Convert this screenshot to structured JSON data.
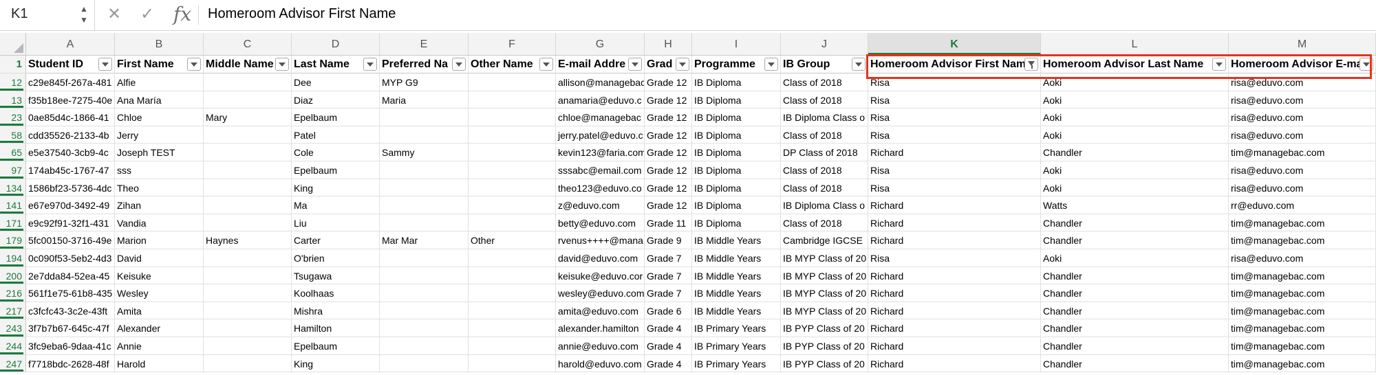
{
  "formula_bar": {
    "name_box": "K1",
    "formula": "Homeroom Advisor First Name",
    "cancel_icon": "x-icon",
    "enter_icon": "check-icon",
    "fx_label": "fx"
  },
  "columns": [
    "A",
    "B",
    "C",
    "D",
    "E",
    "F",
    "G",
    "H",
    "I",
    "J",
    "K",
    "L",
    "M"
  ],
  "header_row_number": "1",
  "headers": [
    "Student ID",
    "First Name",
    "Middle Name",
    "Last Name",
    "Preferred Name",
    "Other Name",
    "E-mail Address",
    "Grade",
    "Programme",
    "IB Group",
    "Homeroom Advisor First Name",
    "Homeroom Advisor Last Name",
    "Homeroom Advisor E-mail"
  ],
  "header_display": [
    "Student ID",
    "First Name",
    "Middle Name",
    "Last Name",
    "Preferred Na",
    "Other Name",
    "E-mail Addre",
    "Grad",
    "Programme",
    "IB Group",
    "Homeroom Advisor First Nam",
    "Homeroom Advisor Last Name",
    "Homeroom Advisor E-mail"
  ],
  "selected_column": "K",
  "rows": [
    {
      "num": "12",
      "cells": [
        "c29e845f-267a-481",
        "Alfie",
        "",
        "Dee",
        "MYP G9",
        "",
        "allison@managebac",
        "Grade 12",
        "IB Diploma",
        "Class of 2018",
        "Risa",
        "Aoki",
        "risa@eduvo.com"
      ]
    },
    {
      "num": "13",
      "cells": [
        "f35b18ee-7275-40e",
        "Ana María",
        "",
        "Diaz",
        "Maria",
        "",
        "anamaria@eduvo.c",
        "Grade 12",
        "IB Diploma",
        "Class of 2018",
        "Risa",
        "Aoki",
        "risa@eduvo.com"
      ]
    },
    {
      "num": "23",
      "cells": [
        "0ae85d4c-1866-41",
        "Chloe",
        "Mary",
        "Epelbaum",
        "",
        "",
        "chloe@managebac",
        "Grade 12",
        "IB Diploma",
        "IB Diploma Class o",
        "Risa",
        "Aoki",
        "risa@eduvo.com"
      ]
    },
    {
      "num": "58",
      "cells": [
        "cdd35526-2133-4b",
        "Jerry",
        "",
        "Patel",
        "",
        "",
        "jerry.patel@eduvo.c",
        "Grade 12",
        "IB Diploma",
        "Class of 2018",
        "Risa",
        "Aoki",
        "risa@eduvo.com"
      ]
    },
    {
      "num": "65",
      "cells": [
        "e5e37540-3cb9-4c",
        "Joseph TEST",
        "",
        "Cole",
        "Sammy",
        "",
        "kevin123@faria.com",
        "Grade 12",
        "IB Diploma",
        "DP Class of 2018",
        "Richard",
        "Chandler",
        "tim@managebac.com"
      ]
    },
    {
      "num": "97",
      "cells": [
        "174ab45c-1767-47",
        "sss",
        "",
        "Epelbaum",
        "",
        "",
        "sssabc@email.com",
        "Grade 12",
        "IB Diploma",
        "Class of 2018",
        "Risa",
        "Aoki",
        "risa@eduvo.com"
      ]
    },
    {
      "num": "134",
      "cells": [
        "1586bf23-5736-4dc",
        "Theo",
        "",
        "King",
        "",
        "",
        "theo123@eduvo.co",
        "Grade 12",
        "IB Diploma",
        "Class of 2018",
        "Risa",
        "Aoki",
        "risa@eduvo.com"
      ]
    },
    {
      "num": "141",
      "cells": [
        "e67e970d-3492-49",
        "Zihan",
        "",
        "Ma",
        "",
        "",
        "z@eduvo.com",
        "Grade 12",
        "IB Diploma",
        "IB Diploma Class o",
        "Richard",
        "Watts",
        "rr@eduvo.com"
      ]
    },
    {
      "num": "171",
      "cells": [
        "e9c92f91-32f1-431",
        "Vandia",
        "",
        "Liu",
        "",
        "",
        "betty@eduvo.com",
        "Grade 11",
        "IB Diploma",
        "Class of 2018",
        "Richard",
        "Chandler",
        "tim@managebac.com"
      ]
    },
    {
      "num": "179",
      "cells": [
        "5fc00150-3716-49e",
        "Marion",
        "Haynes",
        "Carter",
        "Mar Mar",
        "Other",
        "rvenus++++@mana",
        "Grade 9",
        "IB Middle Years",
        "Cambridge IGCSE",
        "Richard",
        "Chandler",
        "tim@managebac.com"
      ]
    },
    {
      "num": "194",
      "cells": [
        "0c090f53-5eb2-4d3",
        "David",
        "",
        "O'brien",
        "",
        "",
        "david@eduvo.com",
        "Grade 7",
        "IB Middle Years",
        "IB MYP Class of 20",
        "Risa",
        "Aoki",
        "risa@eduvo.com"
      ]
    },
    {
      "num": "200",
      "cells": [
        "2e7dda84-52ea-45",
        "Keisuke",
        "",
        "Tsugawa",
        "",
        "",
        "keisuke@eduvo.cor",
        "Grade 7",
        "IB Middle Years",
        "IB MYP Class of 20",
        "Richard",
        "Chandler",
        "tim@managebac.com"
      ]
    },
    {
      "num": "216",
      "cells": [
        "561f1e75-61b8-435",
        "Wesley",
        "",
        "Koolhaas",
        "",
        "",
        "wesley@eduvo.com",
        "Grade 7",
        "IB Middle Years",
        "IB MYP Class of 20",
        "Richard",
        "Chandler",
        "tim@managebac.com"
      ]
    },
    {
      "num": "217",
      "cells": [
        "c3fcfc43-3c2e-43ft",
        "Amita",
        "",
        "Mishra",
        "",
        "",
        "amita@eduvo.com",
        "Grade 6",
        "IB Middle Years",
        "IB MYP Class of 20",
        "Richard",
        "Chandler",
        "tim@managebac.com"
      ]
    },
    {
      "num": "243",
      "cells": [
        "3f7b7b67-645c-47f",
        "Alexander",
        "",
        "Hamilton",
        "",
        "",
        "alexander.hamilton",
        "Grade 4",
        "IB Primary Years",
        "IB PYP Class of 20",
        "Richard",
        "Chandler",
        "tim@managebac.com"
      ]
    },
    {
      "num": "244",
      "cells": [
        "3fc9eba6-9daa-41c",
        "Annie",
        "",
        "Epelbaum",
        "",
        "",
        "annie@eduvo.com",
        "Grade 4",
        "IB Primary Years",
        "IB PYP Class of 20",
        "Richard",
        "Chandler",
        "tim@managebac.com"
      ]
    },
    {
      "num": "247",
      "cells": [
        "f7718bdc-2628-48f",
        "Harold",
        "",
        "King",
        "",
        "",
        "harold@eduvo.com",
        "Grade 4",
        "IB Primary Years",
        "IB PYP Class of 20",
        "Richard",
        "Chandler",
        "tim@managebac.com"
      ]
    }
  ],
  "colors": {
    "accent": "#1c7a3c",
    "highlight": "#e5331c",
    "grid": "#e0e0e0",
    "header_bg": "#f3f3f3"
  }
}
